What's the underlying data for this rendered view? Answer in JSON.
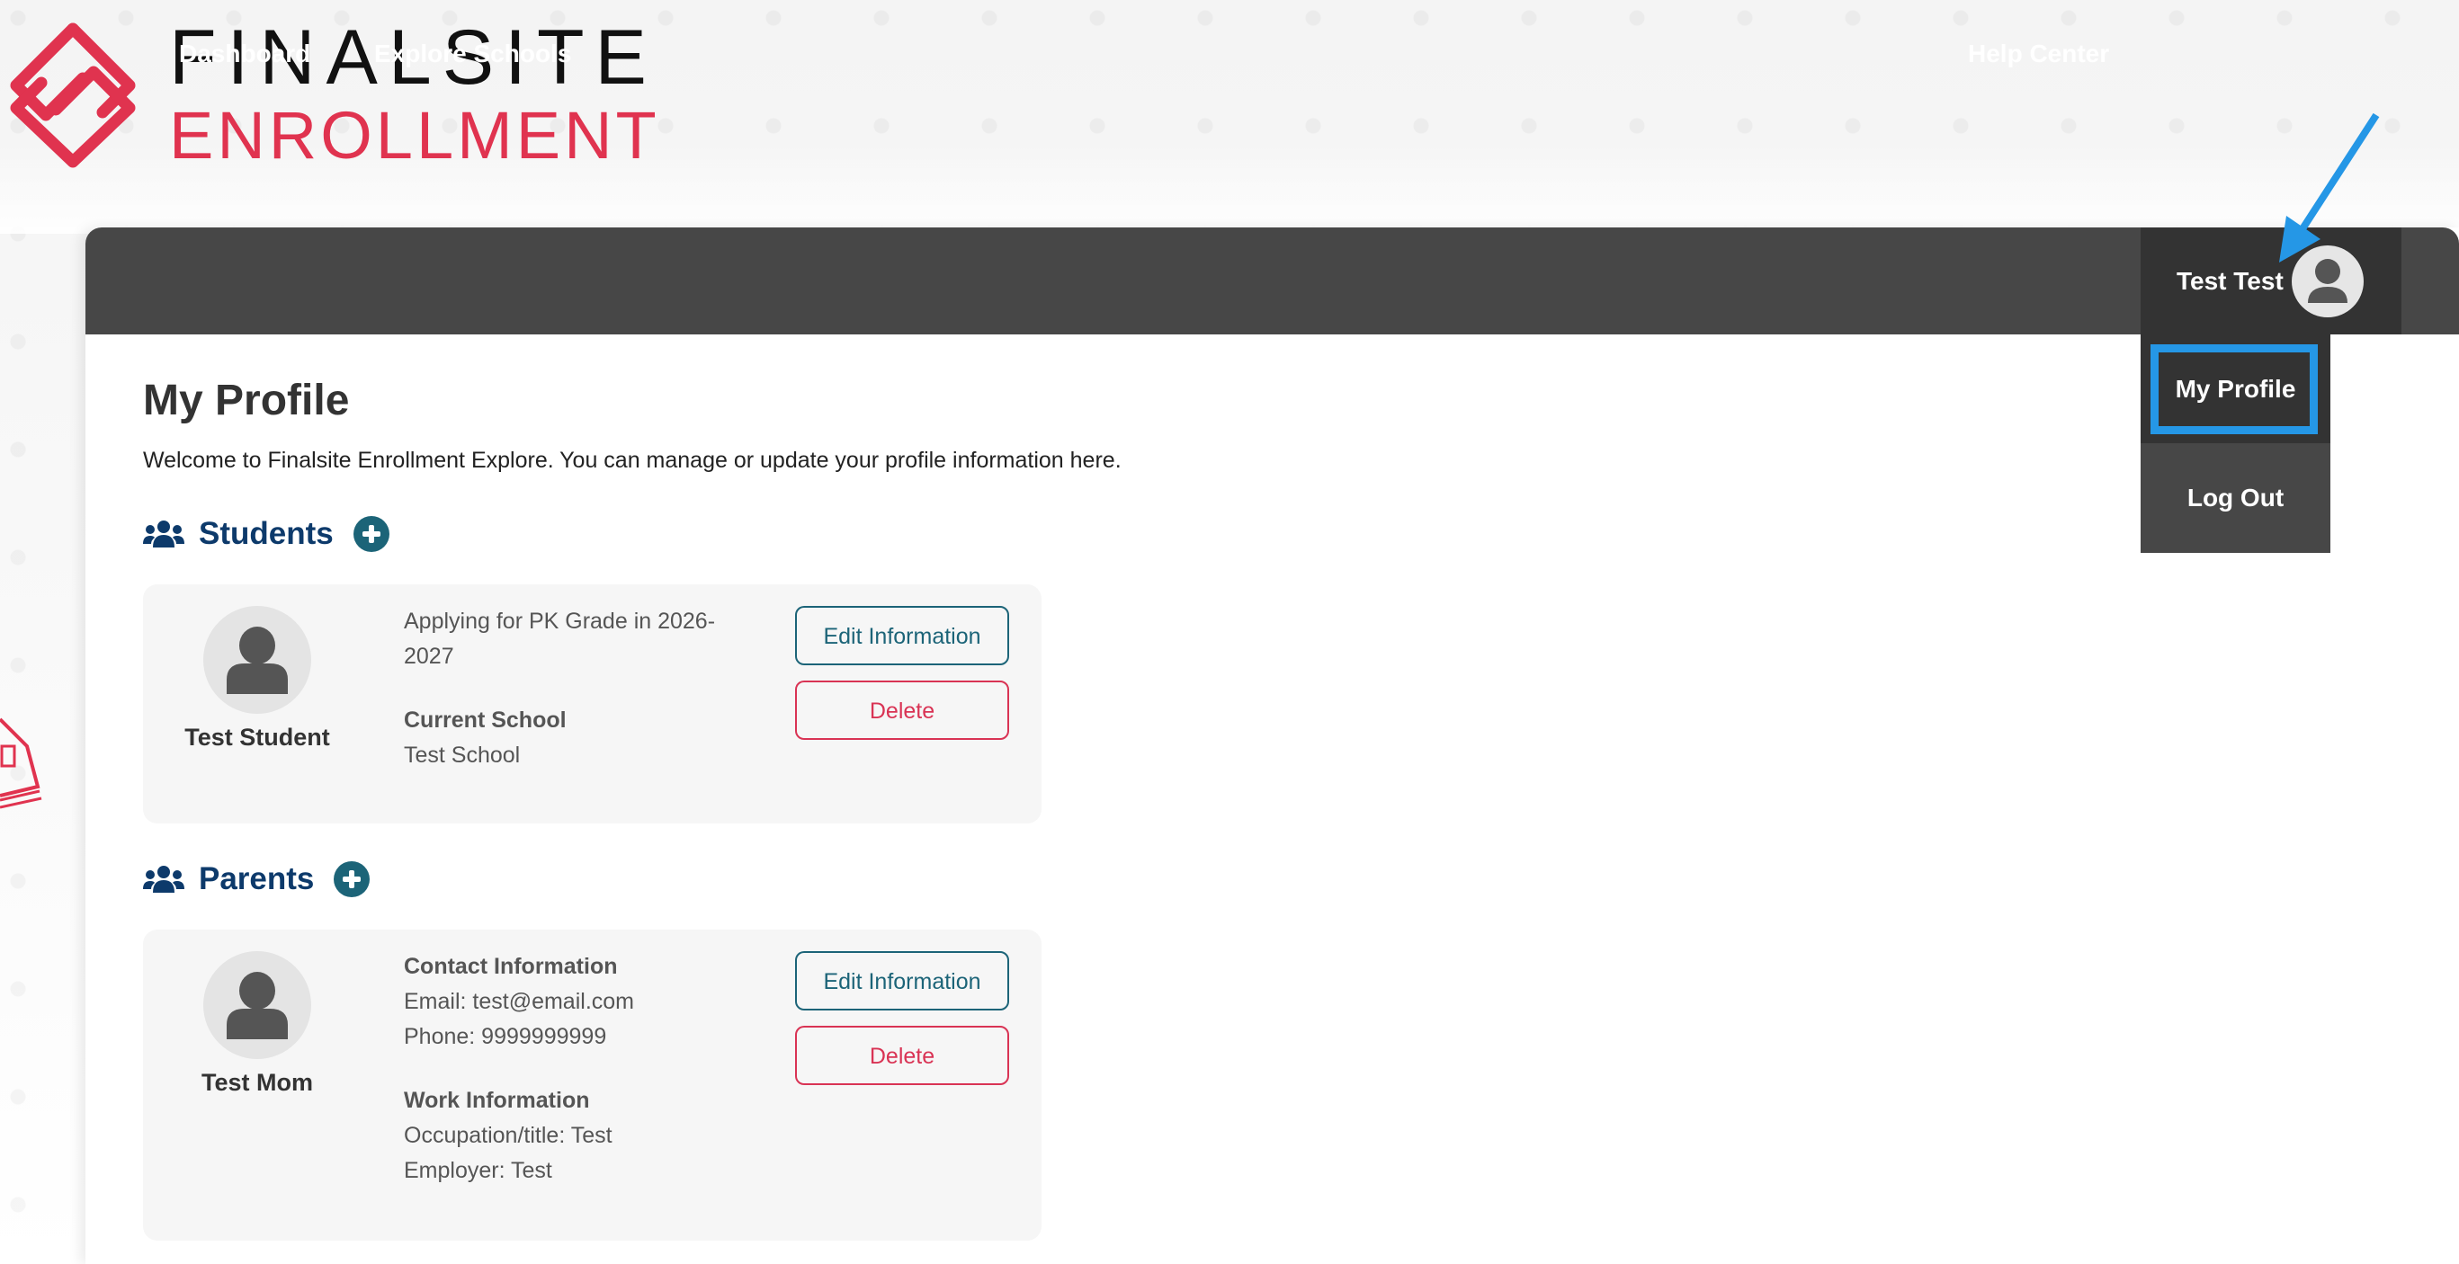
{
  "brand": {
    "line1": "FINALSITE",
    "line2": "ENROLLMENT",
    "accent_color": "#e0334f"
  },
  "nav": {
    "links": [
      {
        "label": "Dashboard"
      },
      {
        "label": "Explore Schools"
      },
      {
        "label": "Help Center"
      }
    ],
    "user": {
      "name": "Test Test",
      "avatar_icon": "user-avatar-icon"
    },
    "dropdown": [
      {
        "label": "My Profile",
        "active": true
      },
      {
        "label": "Log Out",
        "active": false
      }
    ],
    "highlight_color": "#2597e6"
  },
  "page": {
    "title": "My Profile",
    "welcome": "Welcome to Finalsite Enrollment Explore. You can manage or update your profile information here."
  },
  "students": {
    "title": "Students",
    "icon": "users-icon",
    "add_icon": "plus-circle-icon",
    "items": [
      {
        "name": "Test Student",
        "applying_line1": "Applying for PK Grade in 2026-",
        "applying_line2": "2027",
        "school_label": "Current School",
        "school_value": "Test School",
        "edit_label": "Edit Information",
        "delete_label": "Delete"
      }
    ]
  },
  "parents": {
    "title": "Parents",
    "icon": "users-icon",
    "add_icon": "plus-circle-icon",
    "items": [
      {
        "name": "Test Mom",
        "contact_label": "Contact Information",
        "email": "Email: test@email.com",
        "phone": "Phone: 9999999999",
        "work_label": "Work Information",
        "occupation": "Occupation/title: Test",
        "employer": "Employer: Test",
        "edit_label": "Edit Information",
        "delete_label": "Delete"
      }
    ]
  }
}
